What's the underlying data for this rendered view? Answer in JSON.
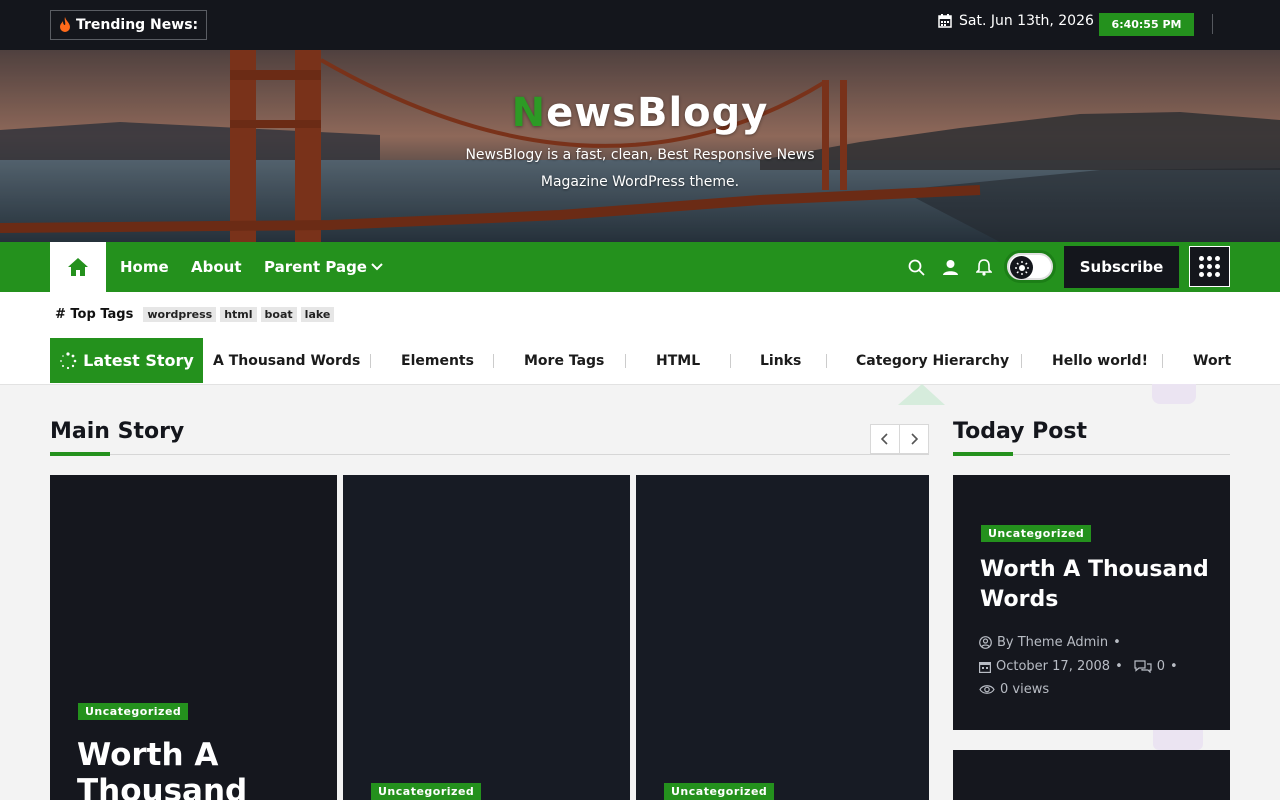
{
  "topbar": {
    "trending_label": "Trending News:",
    "date": "Sat. Jun 13th, 2026",
    "time": "6:40:55 PM"
  },
  "header": {
    "title_first": "N",
    "title_rest": "ewsBlogy",
    "description": "NewsBlogy is a fast, clean, Best Responsive News Magazine WordPress theme."
  },
  "nav": {
    "items": [
      {
        "label": "Home"
      },
      {
        "label": "About"
      },
      {
        "label": "Parent Page"
      }
    ],
    "subscribe_label": "Subscribe"
  },
  "tags": {
    "label": "# Top Tags",
    "items": [
      "wordpress",
      "html",
      "boat",
      "lake"
    ]
  },
  "latest": {
    "label": "Latest Story",
    "items": [
      "A Thousand Words",
      "Elements",
      "More Tags",
      "HTML",
      "Links",
      "Category Hierarchy",
      "Hello world!",
      "Worth"
    ]
  },
  "main_story": {
    "title": "Main Story",
    "cards": [
      {
        "category": "Uncategorized",
        "title_line1": "Worth A",
        "title_line2": "Thousand"
      },
      {
        "category": "Uncategorized"
      },
      {
        "category": "Uncategorized"
      }
    ]
  },
  "today_post": {
    "title": "Today Post",
    "card": {
      "category": "Uncategorized",
      "title": "Worth A Thousand Words",
      "author": "By Theme Admin",
      "date": "October 17, 2008",
      "comments": "0",
      "views": "0 views"
    }
  },
  "colors": {
    "accent": "#24911d",
    "dark": "#14161c"
  }
}
